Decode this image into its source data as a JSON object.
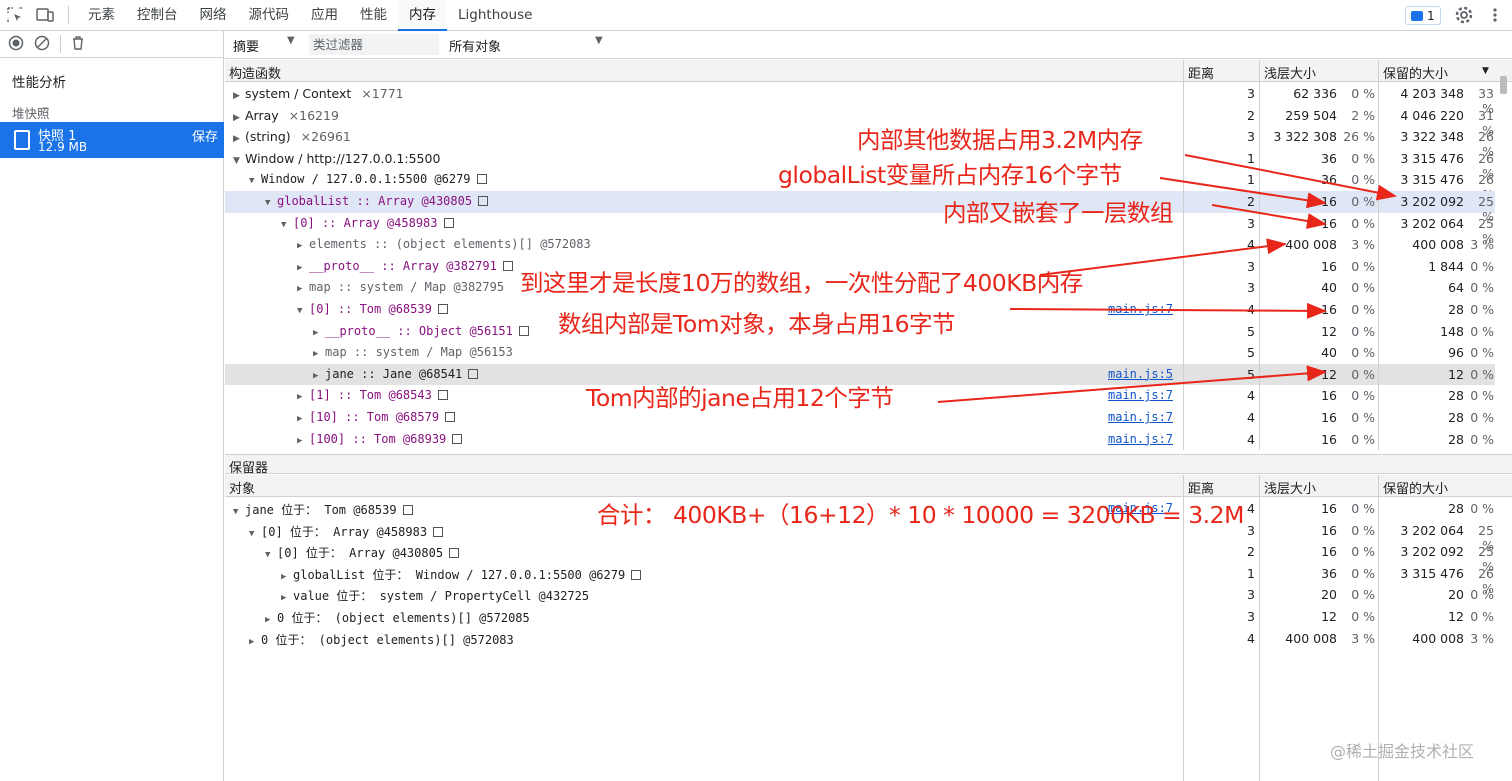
{
  "toolbar": {
    "tabs": [
      "元素",
      "控制台",
      "网络",
      "源代码",
      "应用",
      "性能",
      "内存",
      "Lighthouse"
    ],
    "active_tab": "内存",
    "issues_count": "1"
  },
  "sidebar": {
    "section_title": "性能分析",
    "heap_header": "堆快照",
    "snapshot": {
      "name": "快照 1",
      "size": "12.9 MB",
      "save_label": "保存"
    }
  },
  "filter": {
    "view": "摘要",
    "class_filter_placeholder": "类过滤器",
    "objects": "所有对象"
  },
  "main_table": {
    "headers": {
      "constructor": "构造函数",
      "distance": "距离",
      "shallow": "浅层大小",
      "retained": "保留的大小"
    },
    "rows": [
      {
        "label": "system / Context",
        "count": "×1771",
        "distance": "3",
        "shallow": "62 336",
        "shallow_pct": "0 %",
        "retained": "4 203 348",
        "retained_pct": "33 %"
      },
      {
        "label": "Array",
        "count": "×16219",
        "distance": "2",
        "shallow": "259 504",
        "shallow_pct": "2 %",
        "retained": "4 046 220",
        "retained_pct": "31 %"
      },
      {
        "label": "(string)",
        "count": "×26961",
        "distance": "3",
        "shallow": "3 322 308",
        "shallow_pct": "26 %",
        "retained": "3 322 348",
        "retained_pct": "26 %"
      },
      {
        "label": "Window / http://127.0.0.1:5500",
        "count": "",
        "distance": "1",
        "shallow": "36",
        "shallow_pct": "0 %",
        "retained": "3 315 476",
        "retained_pct": "26 %"
      },
      {
        "label": "Window / 127.0.0.1:5500 @6279",
        "count": "",
        "distance": "1",
        "shallow": "36",
        "shallow_pct": "0 %",
        "retained": "3 315 476",
        "retained_pct": "26 %"
      },
      {
        "label": "globalList :: Array @430805",
        "count": "",
        "distance": "2",
        "shallow": "16",
        "shallow_pct": "0 %",
        "retained": "3 202 092",
        "retained_pct": "25 %"
      },
      {
        "label": "[0] :: Array @458983",
        "count": "",
        "distance": "3",
        "shallow": "16",
        "shallow_pct": "0 %",
        "retained": "3 202 064",
        "retained_pct": "25 %"
      },
      {
        "label": "elements :: (object elements)[] @572083",
        "count": "",
        "distance": "4",
        "shallow": "400 008",
        "shallow_pct": "3 %",
        "retained": "400 008",
        "retained_pct": "3 %"
      },
      {
        "label": "__proto__ :: Array @382791",
        "count": "",
        "distance": "3",
        "shallow": "16",
        "shallow_pct": "0 %",
        "retained": "1 844",
        "retained_pct": "0 %"
      },
      {
        "label": "map :: system / Map @382795",
        "count": "",
        "distance": "3",
        "shallow": "40",
        "shallow_pct": "0 %",
        "retained": "64",
        "retained_pct": "0 %"
      },
      {
        "label": "[0] :: Tom @68539",
        "count": "",
        "link": "main.js:7",
        "distance": "4",
        "shallow": "16",
        "shallow_pct": "0 %",
        "retained": "28",
        "retained_pct": "0 %"
      },
      {
        "label": "__proto__ :: Object @56151",
        "count": "",
        "distance": "5",
        "shallow": "12",
        "shallow_pct": "0 %",
        "retained": "148",
        "retained_pct": "0 %"
      },
      {
        "label": "map :: system / Map @56153",
        "count": "",
        "distance": "5",
        "shallow": "40",
        "shallow_pct": "0 %",
        "retained": "96",
        "retained_pct": "0 %"
      },
      {
        "label": "jane :: Jane @68541",
        "count": "",
        "link": "main.js:5",
        "distance": "5",
        "shallow": "12",
        "shallow_pct": "0 %",
        "retained": "12",
        "retained_pct": "0 %"
      },
      {
        "label": "[1] :: Tom @68543",
        "count": "",
        "link": "main.js:7",
        "distance": "4",
        "shallow": "16",
        "shallow_pct": "0 %",
        "retained": "28",
        "retained_pct": "0 %"
      },
      {
        "label": "[10] :: Tom @68579",
        "count": "",
        "link": "main.js:7",
        "distance": "4",
        "shallow": "16",
        "shallow_pct": "0 %",
        "retained": "28",
        "retained_pct": "0 %"
      },
      {
        "label": "[100] :: Tom @68939",
        "count": "",
        "link": "main.js:7",
        "distance": "4",
        "shallow": "16",
        "shallow_pct": "0 %",
        "retained": "28",
        "retained_pct": "0 %"
      }
    ]
  },
  "retainers": {
    "title": "保留器",
    "headers": {
      "object": "对象",
      "distance": "距离",
      "shallow": "浅层大小",
      "retained": "保留的大小"
    },
    "rows": [
      {
        "label": "jane 位于： Tom @68539",
        "link": "main.js:7",
        "distance": "4",
        "shallow": "16",
        "shallow_pct": "0 %",
        "retained": "28",
        "retained_pct": "0 %"
      },
      {
        "label": "[0] 位于： Array @458983",
        "distance": "3",
        "shallow": "16",
        "shallow_pct": "0 %",
        "retained": "3 202 064",
        "retained_pct": "25 %"
      },
      {
        "label": "[0] 位于： Array @430805",
        "distance": "2",
        "shallow": "16",
        "shallow_pct": "0 %",
        "retained": "3 202 092",
        "retained_pct": "25 %"
      },
      {
        "label": "globalList 位于： Window / 127.0.0.1:5500 @6279",
        "distance": "1",
        "shallow": "36",
        "shallow_pct": "0 %",
        "retained": "3 315 476",
        "retained_pct": "26 %"
      },
      {
        "label": "value 位于： system / PropertyCell @432725",
        "distance": "3",
        "shallow": "20",
        "shallow_pct": "0 %",
        "retained": "20",
        "retained_pct": "0 %"
      },
      {
        "label": "0 位于： (object elements)[] @572085",
        "distance": "3",
        "shallow": "12",
        "shallow_pct": "0 %",
        "retained": "12",
        "retained_pct": "0 %"
      },
      {
        "label": "0 位于： (object elements)[] @572083",
        "distance": "4",
        "shallow": "400 008",
        "shallow_pct": "3 %",
        "retained": "400 008",
        "retained_pct": "3 %"
      }
    ]
  },
  "annotations": {
    "a1": "内部其他数据占用3.2M内存",
    "a2": "globalList变量所占内存16个字节",
    "a3": "内部又嵌套了一层数组",
    "a4": "到这里才是长度10万的数组，一次性分配了400KB内存",
    "a5": "数组内部是Tom对象，本身占用16字节",
    "a6": "Tom内部的jane占用12个字节",
    "a7": "合计： 400KB+（16+12）* 10 * 10000 = 3200KB = 3.2M"
  },
  "watermark": "@稀土掘金技术社区",
  "colors": {
    "accent": "#1a73e8",
    "annotation": "#e8261a",
    "link": "#1155cc"
  }
}
